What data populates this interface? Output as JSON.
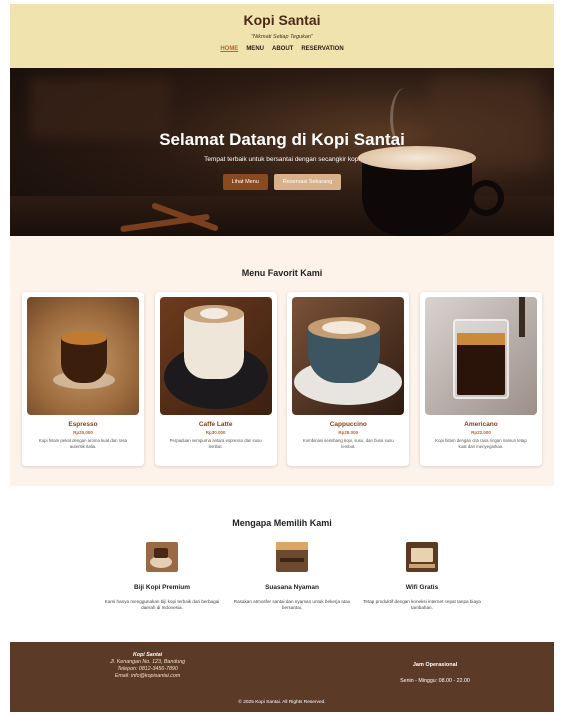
{
  "header": {
    "brand": "Kopi Santai",
    "tagline": "\"Nikmati Setiap Tegukan\"",
    "nav": [
      {
        "label": "HOME",
        "active": true
      },
      {
        "label": "MENU",
        "active": false
      },
      {
        "label": "ABOUT",
        "active": false
      },
      {
        "label": "RESERVATION",
        "active": false
      }
    ]
  },
  "hero": {
    "title": "Selamat Datang di Kopi Santai",
    "subtitle": "Tempat terbaik untuk bersantai dengan secangkir kopi",
    "primary_button": "Lihat Menu",
    "secondary_button": "Reservasi Sekarang"
  },
  "menu": {
    "title": "Menu Favorit Kami",
    "items": [
      {
        "name": "Espresso",
        "price": "Rp25.000",
        "description": "Kopi hitam pekat dengan aroma kuat dan rasa autentik Italia.",
        "image": "espresso-photo"
      },
      {
        "name": "Caffe Latte",
        "price": "Rp30.000",
        "description": "Perpaduan sempurna antara espresso dan susu lembut.",
        "image": "latte-photo"
      },
      {
        "name": "Cappuccino",
        "price": "Rp28.000",
        "description": "Kombinasi seimbang kopi, susu, dan busa susu lembut.",
        "image": "cappuccino-photo"
      },
      {
        "name": "Americano",
        "price": "Rp22.000",
        "description": "Kopi hitam dengan cita rasa ringan namun tetap kuat dan menyegarkan.",
        "image": "americano-photo"
      }
    ]
  },
  "why": {
    "title": "Mengapa Memilih Kami",
    "features": [
      {
        "title": "Biji Kopi Premium",
        "description": "Kami hanya menggunakan biji kopi terbaik dari berbagai daerah di Indonesia.",
        "icon": "coffee-beans-icon"
      },
      {
        "title": "Suasana Nyaman",
        "description": "Rasakan atmosfer santai dan nyaman untuk bekerja atau bersantai.",
        "icon": "cafe-interior-icon"
      },
      {
        "title": "Wifi Gratis",
        "description": "Tetap produktif dengan koneksi internet cepat tanpa biaya tambahan.",
        "icon": "laptop-coffee-icon"
      }
    ]
  },
  "footer": {
    "name": "Kopi Santai",
    "address": "Jl. Kenangan No. 123, Bandung",
    "phone": "Telepon: 0812-3456-7890",
    "email": "Email: info@kopisantai.com",
    "hours_title": "Jam Operasional",
    "hours": "Senin - Minggu: 08.00 - 22.00",
    "copyright": "© 2025 Kopi Santai. All Rights Reserved."
  },
  "colors": {
    "header_bg": "#f1e3ae",
    "accent": "#8a4a1f",
    "menu_bg": "#fdf3ea",
    "footer_bg": "#5b3a28"
  }
}
